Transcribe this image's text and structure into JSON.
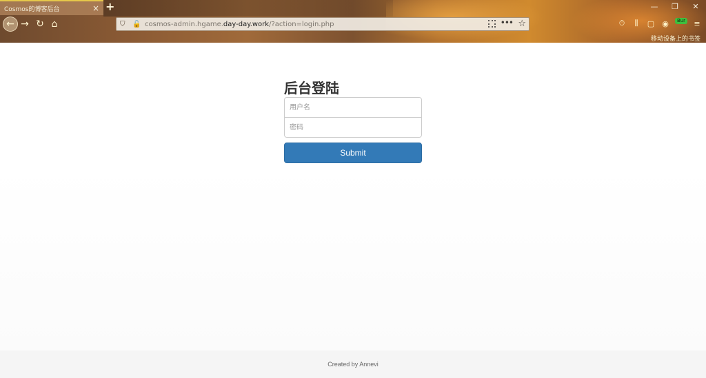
{
  "browser": {
    "tab": {
      "title": "Cosmos的博客后台",
      "close_glyph": "×"
    },
    "new_tab_glyph": "+",
    "window_controls": [
      "—",
      "❐",
      "✕"
    ],
    "nav": {
      "back": "←",
      "forward": "→",
      "reload": "↻",
      "home": "⌂"
    },
    "url": {
      "prefix": "cosmos-admin.hgame.",
      "domain": "day-day.work",
      "suffix": "/?action=login.php"
    },
    "url_more": "•••",
    "url_star": "☆",
    "toolbar_icons": [
      "⏱",
      "⫼",
      "▢",
      "◉",
      "⚲",
      "≡"
    ],
    "burp_badge": "Bur",
    "bookmark_mobile": "移动设备上的书签"
  },
  "login": {
    "title": "后台登陆",
    "username_placeholder": "用户名",
    "password_placeholder": "密码",
    "submit_label": "Submit"
  },
  "footer": {
    "text": "Created by Annevi"
  },
  "colors": {
    "accent": "#337ab7",
    "footer_bg": "#f5f5f5"
  }
}
